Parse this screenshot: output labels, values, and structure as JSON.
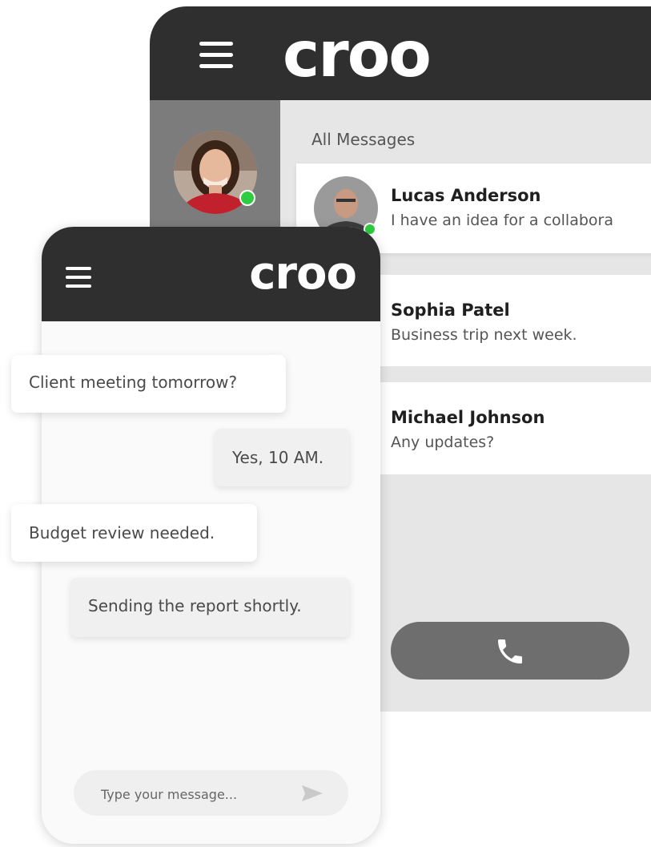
{
  "desktop": {
    "logo": "croo",
    "section_title": "All Messages",
    "conversations": [
      {
        "name": "Lucas Anderson",
        "preview": "I have an idea for a collabora",
        "online": true
      },
      {
        "name": "Sophia Patel",
        "preview": "Business trip next week."
      },
      {
        "name": "Michael Johnson",
        "preview": "Any updates?"
      }
    ],
    "current_user": {
      "online": true
    },
    "icons": [
      "hamburger-icon",
      "phone-icon"
    ]
  },
  "mobile": {
    "logo": "croo",
    "messages": [
      {
        "direction": "in",
        "text": "Client meeting tomorrow?"
      },
      {
        "direction": "out",
        "text": "Yes, 10 AM."
      },
      {
        "direction": "in",
        "text": "Budget review needed."
      },
      {
        "direction": "out",
        "text": "Sending the report shortly."
      }
    ],
    "input": {
      "placeholder": "Type your message..."
    },
    "icons": [
      "hamburger-icon",
      "send-icon"
    ]
  },
  "colors": {
    "header": "#2f2f2f",
    "sidebar": "#7c7c7c",
    "online": "#2ecc40",
    "call_button": "#6e6e6e"
  }
}
